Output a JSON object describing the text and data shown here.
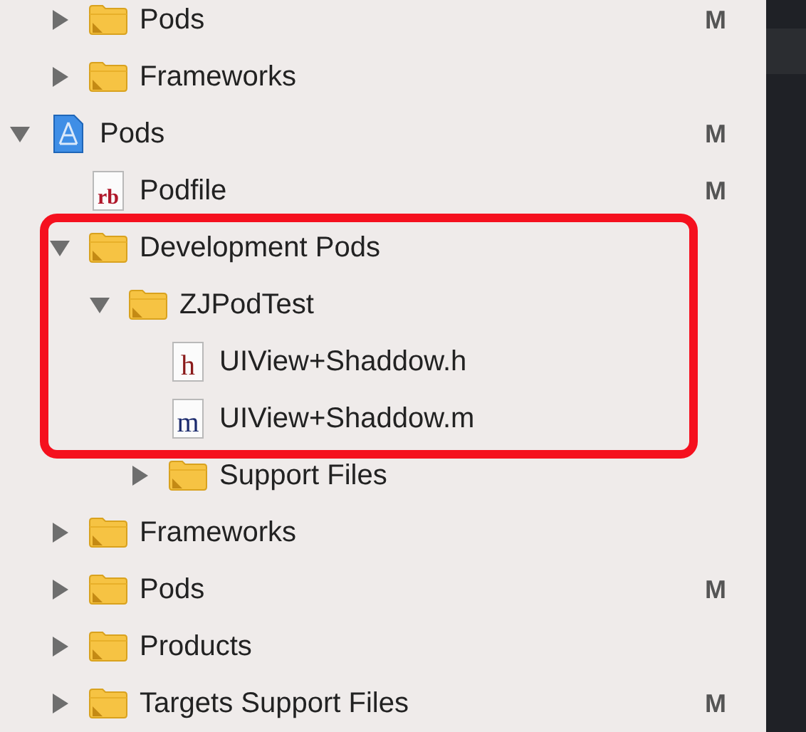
{
  "navigator": {
    "continued": [
      {
        "kind": "folder",
        "name": "Pods",
        "expanded": false,
        "status": "M"
      },
      {
        "kind": "folder",
        "name": "Frameworks",
        "expanded": false
      }
    ],
    "items": [
      {
        "kind": "project",
        "name": "Pods",
        "expanded": true,
        "status": "M",
        "children": [
          {
            "kind": "ruby",
            "icon_text": "rb",
            "name": "Podfile",
            "status": "M"
          },
          {
            "kind": "folder",
            "name": "Development Pods",
            "expanded": true,
            "highlighted": true,
            "children": [
              {
                "kind": "folder",
                "name": "ZJPodTest",
                "expanded": true,
                "highlighted": true,
                "children": [
                  {
                    "kind": "header",
                    "icon_text": "h",
                    "name": "UIView+Shaddow.h",
                    "highlighted": true
                  },
                  {
                    "kind": "source",
                    "icon_text": "m",
                    "name": "UIView+Shaddow.m",
                    "highlighted": true
                  },
                  {
                    "kind": "folder",
                    "name": "Support Files",
                    "expanded": false
                  }
                ]
              }
            ]
          },
          {
            "kind": "folder",
            "name": "Frameworks",
            "expanded": false
          },
          {
            "kind": "folder",
            "name": "Pods",
            "expanded": false,
            "status": "M"
          },
          {
            "kind": "folder",
            "name": "Products",
            "expanded": false
          },
          {
            "kind": "folder",
            "name": "Targets Support Files",
            "expanded": false,
            "status": "M"
          }
        ]
      }
    ]
  }
}
